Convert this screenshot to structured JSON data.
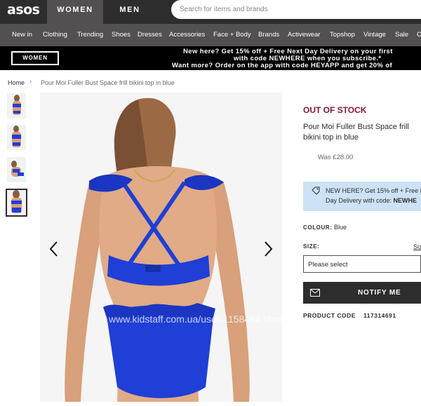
{
  "header": {
    "logo": "asos",
    "gender_tabs": [
      "WOMEN",
      "MEN"
    ],
    "search_placeholder": "Search for items and brands"
  },
  "nav": {
    "categories": [
      "New in",
      "Clothing",
      "Trending",
      "Shoes",
      "Dresses",
      "Accessories",
      "Face + Body",
      "Brands",
      "Activewear",
      "Topshop",
      "Vintage",
      "Sale",
      "C"
    ]
  },
  "promo_bar": {
    "women_button": "WOMEN",
    "line1": "New here? Get 15% off + Free Next Day Delivery on your first",
    "line2": "with code NEWHERE when you subscribe.*",
    "line3": "Want more? Order on the app with code HEYAPP and get 20% of"
  },
  "breadcrumb": {
    "home": "Home",
    "current": "Pour Moi Fuller Bust Space frill bikini top in blue"
  },
  "gallery": {
    "thumbnail_count": 4,
    "active_thumbnail": 4,
    "watermark": "www.kidstaff.com.ua/user-1158464.html"
  },
  "product": {
    "status": "OUT OF STOCK",
    "name": "Pour Moi Fuller Bust Space frill bikini top in blue",
    "was_price": "Was £28.00",
    "promo_line1": "NEW HERE? Get 15% off + Free N",
    "promo_line2_prefix": "Day Delivery with code: ",
    "promo_code": "NEWHE",
    "colour_label": "COLOUR:",
    "colour_value": "Blue",
    "size_label": "SIZE:",
    "size_guide": "Siz",
    "size_select": "Please select",
    "notify_button": "NOTIFY ME",
    "code_label": "PRODUCT CODE",
    "code_value": "117314691"
  },
  "colors": {
    "header_bg": "#2d2d2d",
    "nav_bg": "#525050",
    "out_of_stock": "#8a1538",
    "promo_box": "#cde2f5",
    "bikini_blue": "#1f3fd6"
  },
  "icons": [
    "search-icon",
    "chevron-left-icon",
    "chevron-right-icon",
    "tag-icon",
    "mail-icon"
  ]
}
